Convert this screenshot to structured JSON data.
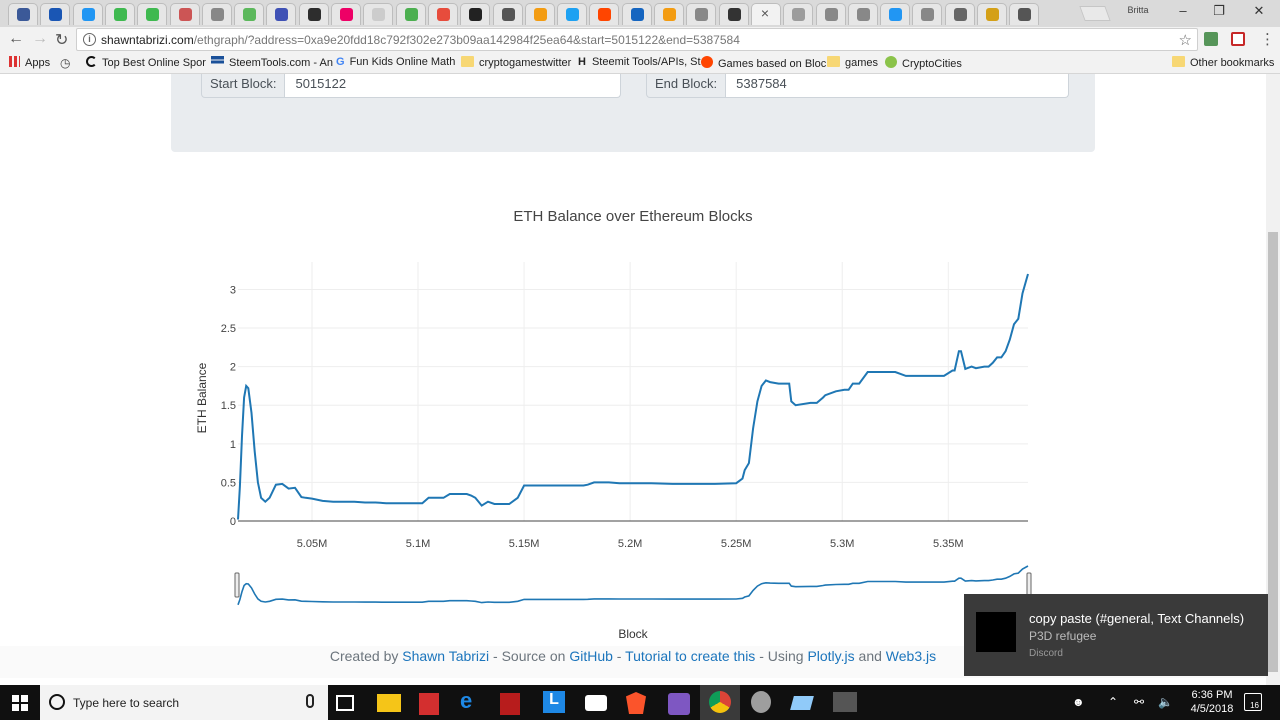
{
  "browser": {
    "profile_name": "Britta",
    "url_host": "shawntabrizi.com",
    "url_rest": "/ethgraph/?address=0xa9e20fdd18c792f302e273b09aa142984f25ea64&start=5015122&end=5387584",
    "tabs_favicon_colors": [
      "#3b5998",
      "#1a56b4",
      "#2196f3",
      "#3fb950",
      "#3fb950",
      "#c55",
      "#888",
      "#5cb85c",
      "#3f51b5",
      "#2d2d2d",
      "#e06",
      "#ccc",
      "#4caf50",
      "#e74c3c",
      "#222",
      "#555",
      "#f39c12",
      "#1da1f2",
      "#ff4500",
      "#1565c0",
      "#f39c12",
      "#888",
      "#333",
      "#888",
      "#9c9c9c",
      "#888",
      "#888",
      "#2196f3",
      "#888",
      "#666",
      "#d4a017",
      "#555"
    ],
    "bookmarks": [
      {
        "label": "Apps",
        "icon": "apps-grid-icon"
      },
      {
        "label": "",
        "icon": "history-icon"
      },
      {
        "label": "Top Best Online Spor",
        "icon": "bookmark-c-icon"
      },
      {
        "label": "SteemTools.com - An",
        "icon": "steem-icon"
      },
      {
        "label": "Fun Kids Online Math",
        "icon": "google-icon"
      },
      {
        "label": "cryptogamestwitter",
        "icon": "folder-icon"
      },
      {
        "label": "Steemit Tools/APIs, St",
        "icon": "h-icon"
      },
      {
        "label": "Games based on Bloc",
        "icon": "reddit-icon"
      },
      {
        "label": "games",
        "icon": "folder-icon"
      },
      {
        "label": "CryptoCities",
        "icon": "cryptocities-icon"
      },
      {
        "label": "Other bookmarks",
        "icon": "folder-icon"
      }
    ]
  },
  "form": {
    "start_label": "Start Block:",
    "start_value": "5015122",
    "end_label": "End Block:",
    "end_value": "5387584"
  },
  "chart_data": {
    "type": "line",
    "title": "ETH Balance over Ethereum Blocks",
    "xlabel": "Block",
    "ylabel": "ETH Balance",
    "xlim": [
      5015122,
      5387584
    ],
    "ylim": [
      0,
      3.2
    ],
    "x_ticks": [
      {
        "value": 5050000,
        "label": "5.05M"
      },
      {
        "value": 5100000,
        "label": "5.1M"
      },
      {
        "value": 5150000,
        "label": "5.15M"
      },
      {
        "value": 5200000,
        "label": "5.2M"
      },
      {
        "value": 5250000,
        "label": "5.25M"
      },
      {
        "value": 5300000,
        "label": "5.3M"
      },
      {
        "value": 5350000,
        "label": "5.35M"
      }
    ],
    "y_ticks": [
      {
        "value": 0,
        "label": "0"
      },
      {
        "value": 0.5,
        "label": "0.5"
      },
      {
        "value": 1,
        "label": "1"
      },
      {
        "value": 1.5,
        "label": "1.5"
      },
      {
        "value": 2,
        "label": "2"
      },
      {
        "value": 2.5,
        "label": "2.5"
      },
      {
        "value": 3,
        "label": "3"
      }
    ],
    "grid": true,
    "range_slider": true,
    "color": "#1f77b4",
    "x": [
      5015122,
      5016000,
      5017000,
      5018000,
      5019000,
      5020000,
      5021500,
      5023000,
      5024500,
      5026000,
      5028000,
      5030000,
      5033000,
      5036000,
      5039000,
      5042000,
      5045000,
      5047000,
      5050000,
      5055000,
      5060000,
      5065000,
      5070000,
      5075000,
      5080000,
      5085000,
      5090000,
      5095000,
      5100000,
      5102000,
      5105000,
      5110000,
      5112000,
      5115000,
      5118000,
      5120000,
      5123000,
      5125000,
      5127000,
      5130000,
      5133000,
      5136000,
      5140000,
      5143000,
      5147000,
      5150000,
      5160000,
      5170000,
      5178000,
      5180000,
      5183000,
      5185000,
      5190000,
      5195000,
      5200000,
      5210000,
      5220000,
      5230000,
      5240000,
      5250000,
      5253000,
      5254000,
      5256000,
      5258000,
      5260000,
      5262000,
      5264000,
      5266000,
      5270000,
      5275000,
      5276000,
      5278000,
      5285000,
      5288000,
      5291000,
      5292000,
      5297000,
      5301000,
      5303000,
      5305000,
      5308000,
      5312000,
      5320000,
      5325000,
      5330000,
      5340000,
      5348000,
      5352000,
      5353000,
      5355000,
      5356000,
      5358000,
      5361000,
      5363000,
      5367000,
      5369000,
      5371000,
      5373000,
      5375000,
      5377000,
      5379000,
      5381000,
      5383000,
      5385000,
      5387584
    ],
    "y": [
      0.02,
      0.45,
      1.1,
      1.6,
      1.75,
      1.72,
      1.4,
      0.9,
      0.5,
      0.3,
      0.25,
      0.3,
      0.47,
      0.48,
      0.42,
      0.43,
      0.31,
      0.3,
      0.29,
      0.26,
      0.25,
      0.25,
      0.25,
      0.24,
      0.24,
      0.23,
      0.23,
      0.23,
      0.23,
      0.23,
      0.3,
      0.3,
      0.3,
      0.35,
      0.35,
      0.35,
      0.35,
      0.33,
      0.3,
      0.2,
      0.25,
      0.22,
      0.22,
      0.22,
      0.3,
      0.46,
      0.46,
      0.46,
      0.46,
      0.47,
      0.5,
      0.5,
      0.5,
      0.49,
      0.49,
      0.49,
      0.48,
      0.48,
      0.48,
      0.49,
      0.55,
      0.66,
      0.75,
      1.2,
      1.55,
      1.75,
      1.82,
      1.8,
      1.78,
      1.78,
      1.55,
      1.5,
      1.53,
      1.53,
      1.6,
      1.63,
      1.68,
      1.7,
      1.7,
      1.78,
      1.78,
      1.93,
      1.93,
      1.93,
      1.88,
      1.88,
      1.88,
      1.95,
      1.95,
      2.2,
      2.2,
      1.97,
      2.0,
      1.98,
      2.0,
      2.0,
      2.05,
      2.12,
      2.12,
      2.2,
      2.35,
      2.55,
      2.62,
      2.95,
      3.2
    ]
  },
  "footer": {
    "t1": "Created by ",
    "author": "Shawn Tabrizi",
    "t2": " - Source on ",
    "github": "GitHub",
    "t3": " - ",
    "tutorial": "Tutorial to create this",
    "t4": " - Using ",
    "plotly": "Plotly.js",
    "t5": " and ",
    "web3": "Web3.js"
  },
  "notification": {
    "title": "copy paste (#general, Text Channels)",
    "subtitle": "P3D refugee",
    "app": "Discord"
  },
  "taskbar": {
    "search_placeholder": "Type here to search",
    "time": "6:36 PM",
    "date": "4/5/2018",
    "notification_count": "16"
  }
}
